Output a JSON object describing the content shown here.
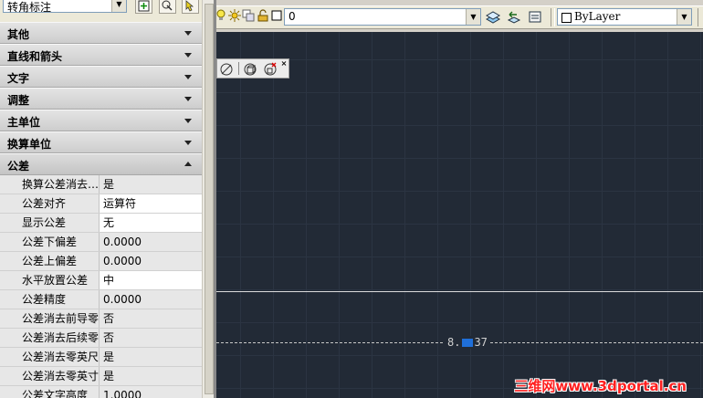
{
  "palette": {
    "type_selector": "转角标注",
    "sections": [
      {
        "label": "其他",
        "expanded": false
      },
      {
        "label": "直线和箭头",
        "expanded": false
      },
      {
        "label": "文字",
        "expanded": false
      },
      {
        "label": "调整",
        "expanded": false
      },
      {
        "label": "主单位",
        "expanded": false
      },
      {
        "label": "换算单位",
        "expanded": false
      },
      {
        "label": "公差",
        "expanded": true
      }
    ],
    "tolerance_rows": [
      {
        "name": "换算公差消去…",
        "value": "是"
      },
      {
        "name": "公差对齐",
        "value": "运算符"
      },
      {
        "name": "显示公差",
        "value": "无"
      },
      {
        "name": "公差下偏差",
        "value": "0.0000"
      },
      {
        "name": "公差上偏差",
        "value": "0.0000"
      },
      {
        "name": "水平放置公差",
        "value": "中"
      },
      {
        "name": "公差精度",
        "value": "0.0000"
      },
      {
        "name": "公差消去前导零",
        "value": "否"
      },
      {
        "name": "公差消去后续零",
        "value": "否"
      },
      {
        "name": "公差消去零英尺",
        "value": "是"
      },
      {
        "name": "公差消去零英寸",
        "value": "是"
      },
      {
        "name": "公差文字高度",
        "value": "1.0000"
      }
    ]
  },
  "toolbar": {
    "layer_name": "0",
    "color": "ByLayer"
  },
  "drawing": {
    "dimension_left": "8.",
    "dimension_right": "37",
    "watermark": "三维网www.3dportal.cn"
  },
  "colors": {
    "canvas": "#222a36",
    "grid": "#2b3442",
    "selection": "#1f6fd9",
    "watermark": "#ff2020"
  }
}
